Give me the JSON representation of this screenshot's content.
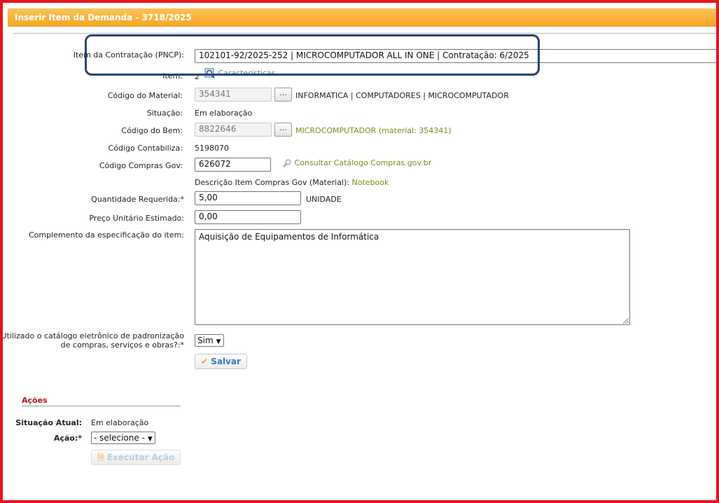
{
  "window": {
    "title": "Inserir Item da Demanda - 3718/2025"
  },
  "form": {
    "item_contratacao": {
      "label": "Item da Contratação (PNCP):",
      "value": "102101-92/2025-252 | MICROCOMPUTADOR ALL IN ONE | Contratação: 6/2025"
    },
    "item": {
      "label": "Item:",
      "value": "2",
      "link": "Características"
    },
    "codigo_material": {
      "label": "Código do Material:",
      "value": "354341",
      "button": "...",
      "description": "INFORMATICA | COMPUTADORES | MICROCOMPUTADOR"
    },
    "situacao": {
      "label": "Situação:",
      "value": "Em elaboração"
    },
    "codigo_bem": {
      "label": "Código do Bem:",
      "value": "8822646",
      "button": "...",
      "description": "MICROCOMPUTADOR (material: 354341)"
    },
    "codigo_contabiliza": {
      "label": "Código Contabiliza:",
      "value": "5198070"
    },
    "codigo_compras_gov": {
      "label": "Código Compras Gov:",
      "value": "626072",
      "link": "Consultar Catálogo Compras.gov.br"
    },
    "descricao_item": {
      "label": "Descrição Item Compras Gov (Material):",
      "value": "Notebook"
    },
    "quantidade": {
      "label": "Quantidade Requerida:*",
      "value": "5,00",
      "unit": "UNIDADE"
    },
    "preco": {
      "label": "Preço Unitário Estimado:",
      "value": "0,00"
    },
    "complemento": {
      "label": "Complemento da especificação do item:",
      "value": "Aquisição de Equipamentos de Informática"
    },
    "catalogo": {
      "label_line1": "Utilizado o catálogo eletrônico de padronização",
      "label_line2": "de compras, serviços e obras?:*",
      "selected": "Sim"
    },
    "save_label": "Salvar"
  },
  "acoes": {
    "title": "Ações",
    "situacao_label": "Situação Atual:",
    "situacao_value": "Em elaboração",
    "acao_label": "Ação:*",
    "acao_selected": "- selecione -",
    "executar_label": "Executar Ação"
  },
  "icons": {
    "search": "search-icon",
    "check": "check-icon",
    "document": "document-icon"
  },
  "colors": {
    "title_bar": "#f5a623",
    "frame": "#e8141b",
    "highlight": "#2a4477",
    "link": "#7a8a1e",
    "section_title": "#b01818"
  }
}
